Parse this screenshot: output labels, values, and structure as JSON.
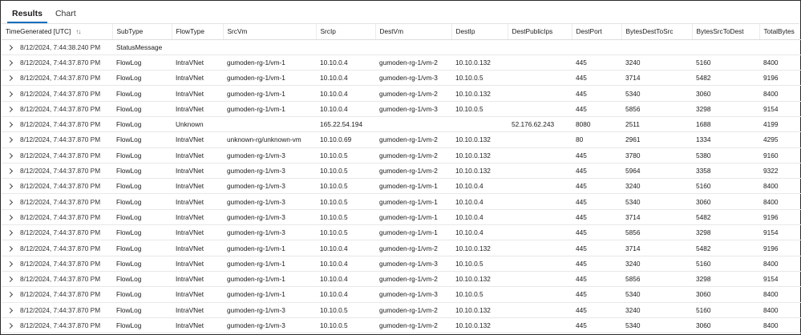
{
  "tabs": [
    {
      "label": "Results",
      "active": true
    },
    {
      "label": "Chart",
      "active": false
    }
  ],
  "columns": [
    "TimeGenerated [UTC]",
    "SubType",
    "FlowType",
    "SrcVm",
    "SrcIp",
    "DestVm",
    "DestIp",
    "DestPublicIps",
    "DestPort",
    "BytesDestToSrc",
    "BytesSrcToDest",
    "TotalBytes"
  ],
  "sort_icon": "↑↓",
  "rows": [
    [
      "8/12/2024, 7:44:38.240 PM",
      "StatusMessage",
      "",
      "",
      "",
      "",
      "",
      "",
      "",
      "",
      "",
      ""
    ],
    [
      "8/12/2024, 7:44:37.870 PM",
      "FlowLog",
      "IntraVNet",
      "gumoden-rg-1/vm-1",
      "10.10.0.4",
      "gumoden-rg-1/vm-2",
      "10.10.0.132",
      "",
      "445",
      "3240",
      "5160",
      "8400"
    ],
    [
      "8/12/2024, 7:44:37.870 PM",
      "FlowLog",
      "IntraVNet",
      "gumoden-rg-1/vm-1",
      "10.10.0.4",
      "gumoden-rg-1/vm-3",
      "10.10.0.5",
      "",
      "445",
      "3714",
      "5482",
      "9196"
    ],
    [
      "8/12/2024, 7:44:37.870 PM",
      "FlowLog",
      "IntraVNet",
      "gumoden-rg-1/vm-1",
      "10.10.0.4",
      "gumoden-rg-1/vm-2",
      "10.10.0.132",
      "",
      "445",
      "5340",
      "3060",
      "8400"
    ],
    [
      "8/12/2024, 7:44:37.870 PM",
      "FlowLog",
      "IntraVNet",
      "gumoden-rg-1/vm-1",
      "10.10.0.4",
      "gumoden-rg-1/vm-3",
      "10.10.0.5",
      "",
      "445",
      "5856",
      "3298",
      "9154"
    ],
    [
      "8/12/2024, 7:44:37.870 PM",
      "FlowLog",
      "Unknown",
      "",
      "165.22.54.194",
      "",
      "",
      "52.176.62.243",
      "8080",
      "2511",
      "1688",
      "4199"
    ],
    [
      "8/12/2024, 7:44:37.870 PM",
      "FlowLog",
      "IntraVNet",
      "unknown-rg/unknown-vm",
      "10.10.0.69",
      "gumoden-rg-1/vm-2",
      "10.10.0.132",
      "",
      "80",
      "2961",
      "1334",
      "4295"
    ],
    [
      "8/12/2024, 7:44:37.870 PM",
      "FlowLog",
      "IntraVNet",
      "gumoden-rg-1/vm-3",
      "10.10.0.5",
      "gumoden-rg-1/vm-2",
      "10.10.0.132",
      "",
      "445",
      "3780",
      "5380",
      "9160"
    ],
    [
      "8/12/2024, 7:44:37.870 PM",
      "FlowLog",
      "IntraVNet",
      "gumoden-rg-1/vm-3",
      "10.10.0.5",
      "gumoden-rg-1/vm-2",
      "10.10.0.132",
      "",
      "445",
      "5964",
      "3358",
      "9322"
    ],
    [
      "8/12/2024, 7:44:37.870 PM",
      "FlowLog",
      "IntraVNet",
      "gumoden-rg-1/vm-3",
      "10.10.0.5",
      "gumoden-rg-1/vm-1",
      "10.10.0.4",
      "",
      "445",
      "3240",
      "5160",
      "8400"
    ],
    [
      "8/12/2024, 7:44:37.870 PM",
      "FlowLog",
      "IntraVNet",
      "gumoden-rg-1/vm-3",
      "10.10.0.5",
      "gumoden-rg-1/vm-1",
      "10.10.0.4",
      "",
      "445",
      "5340",
      "3060",
      "8400"
    ],
    [
      "8/12/2024, 7:44:37.870 PM",
      "FlowLog",
      "IntraVNet",
      "gumoden-rg-1/vm-3",
      "10.10.0.5",
      "gumoden-rg-1/vm-1",
      "10.10.0.4",
      "",
      "445",
      "3714",
      "5482",
      "9196"
    ],
    [
      "8/12/2024, 7:44:37.870 PM",
      "FlowLog",
      "IntraVNet",
      "gumoden-rg-1/vm-3",
      "10.10.0.5",
      "gumoden-rg-1/vm-1",
      "10.10.0.4",
      "",
      "445",
      "5856",
      "3298",
      "9154"
    ],
    [
      "8/12/2024, 7:44:37.870 PM",
      "FlowLog",
      "IntraVNet",
      "gumoden-rg-1/vm-1",
      "10.10.0.4",
      "gumoden-rg-1/vm-2",
      "10.10.0.132",
      "",
      "445",
      "3714",
      "5482",
      "9196"
    ],
    [
      "8/12/2024, 7:44:37.870 PM",
      "FlowLog",
      "IntraVNet",
      "gumoden-rg-1/vm-1",
      "10.10.0.4",
      "gumoden-rg-1/vm-3",
      "10.10.0.5",
      "",
      "445",
      "3240",
      "5160",
      "8400"
    ],
    [
      "8/12/2024, 7:44:37.870 PM",
      "FlowLog",
      "IntraVNet",
      "gumoden-rg-1/vm-1",
      "10.10.0.4",
      "gumoden-rg-1/vm-2",
      "10.10.0.132",
      "",
      "445",
      "5856",
      "3298",
      "9154"
    ],
    [
      "8/12/2024, 7:44:37.870 PM",
      "FlowLog",
      "IntraVNet",
      "gumoden-rg-1/vm-1",
      "10.10.0.4",
      "gumoden-rg-1/vm-3",
      "10.10.0.5",
      "",
      "445",
      "5340",
      "3060",
      "8400"
    ],
    [
      "8/12/2024, 7:44:37.870 PM",
      "FlowLog",
      "IntraVNet",
      "gumoden-rg-1/vm-3",
      "10.10.0.5",
      "gumoden-rg-1/vm-2",
      "10.10.0.132",
      "",
      "445",
      "3240",
      "5160",
      "8400"
    ],
    [
      "8/12/2024, 7:44:37.870 PM",
      "FlowLog",
      "IntraVNet",
      "gumoden-rg-1/vm-3",
      "10.10.0.5",
      "gumoden-rg-1/vm-2",
      "10.10.0.132",
      "",
      "445",
      "5340",
      "3060",
      "8400"
    ]
  ]
}
